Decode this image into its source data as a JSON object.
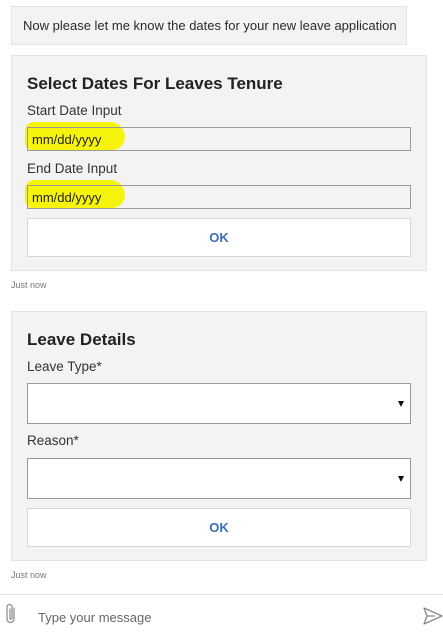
{
  "bot_message": {
    "text": "Now please let me know the dates for your new leave application"
  },
  "dates_card": {
    "title": "Select Dates For Leaves Tenure",
    "start_label": "Start Date Input",
    "start_placeholder": "mm/dd/yyyy",
    "end_label": "End Date Input",
    "end_placeholder": "mm/dd/yyyy",
    "ok_label": "OK",
    "timestamp": "Just now",
    "highlight_color": "#f6f200"
  },
  "leave_card": {
    "title": "Leave Details",
    "leave_type_label": "Leave Type*",
    "leave_type_value": "",
    "reason_label": "Reason*",
    "reason_value": "",
    "ok_label": "OK",
    "timestamp": "Just now"
  },
  "composer": {
    "placeholder": "Type your message",
    "attach_icon": "paperclip-icon",
    "send_icon": "send-icon"
  },
  "colors": {
    "card_background": "#f3f3f3",
    "accent_text": "#3b6fb6"
  }
}
